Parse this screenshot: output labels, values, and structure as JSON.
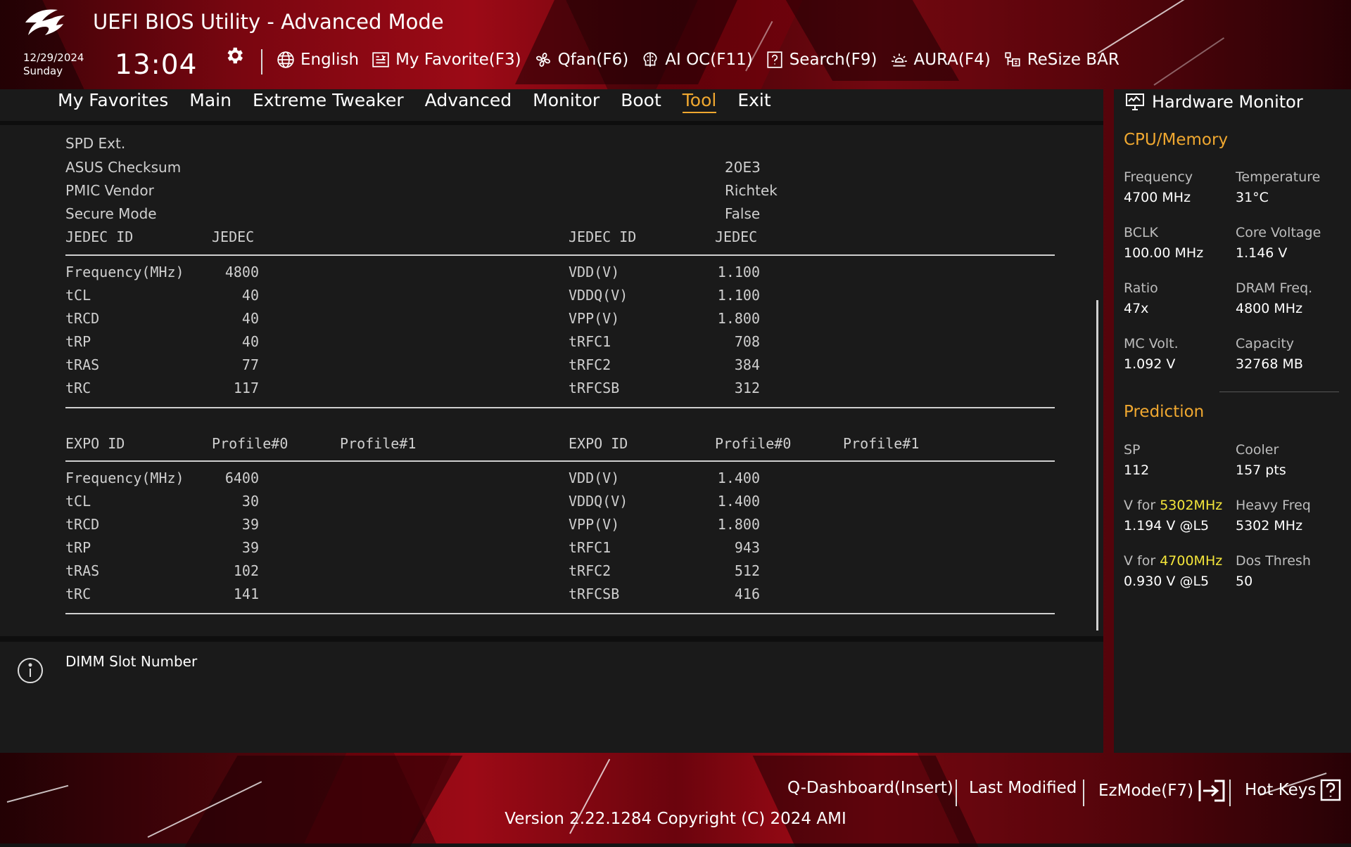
{
  "header": {
    "title": "UEFI BIOS Utility - Advanced Mode",
    "date": "12/29/2024",
    "day": "Sunday",
    "time": "13:04",
    "toolbar": [
      {
        "label": "English",
        "icon": "globe-icon"
      },
      {
        "label": "My Favorite(F3)",
        "icon": "favorite-list-icon"
      },
      {
        "label": "Qfan(F6)",
        "icon": "fan-icon"
      },
      {
        "label": "AI OC(F11)",
        "icon": "ai-chip-icon"
      },
      {
        "label": "Search(F9)",
        "icon": "search-question-icon"
      },
      {
        "label": "AURA(F4)",
        "icon": "aura-light-icon"
      },
      {
        "label": "ReSize BAR",
        "icon": "resize-bar-icon"
      }
    ]
  },
  "menu": {
    "tabs": [
      "My Favorites",
      "Main",
      "Extreme Tweaker",
      "Advanced",
      "Monitor",
      "Boot",
      "Tool",
      "Exit"
    ],
    "active": "Tool"
  },
  "spd": {
    "section": "SPD Ext.",
    "info": [
      {
        "label": "ASUS Checksum",
        "value": "20E3"
      },
      {
        "label": "PMIC Vendor",
        "value": "Richtek"
      },
      {
        "label": "Secure Mode",
        "value": "False"
      }
    ],
    "jedec": {
      "left_header": [
        "JEDEC ID",
        "JEDEC"
      ],
      "right_header": [
        "JEDEC ID",
        "JEDEC"
      ],
      "left_rows": [
        [
          "Frequency(MHz)",
          "4800"
        ],
        [
          "tCL",
          "40"
        ],
        [
          "tRCD",
          "40"
        ],
        [
          "tRP",
          "40"
        ],
        [
          "tRAS",
          "77"
        ],
        [
          "tRC",
          "117"
        ]
      ],
      "right_rows": [
        [
          "VDD(V)",
          "1.100"
        ],
        [
          "VDDQ(V)",
          "1.100"
        ],
        [
          "VPP(V)",
          "1.800"
        ],
        [
          "tRFC1",
          "708"
        ],
        [
          "tRFC2",
          "384"
        ],
        [
          "tRFCSB",
          "312"
        ]
      ]
    },
    "expo": {
      "left_header": [
        "EXPO ID",
        "Profile#0",
        "Profile#1"
      ],
      "right_header": [
        "EXPO ID",
        "Profile#0",
        "Profile#1"
      ],
      "left_rows": [
        [
          "Frequency(MHz)",
          "6400"
        ],
        [
          "tCL",
          "30"
        ],
        [
          "tRCD",
          "39"
        ],
        [
          "tRP",
          "39"
        ],
        [
          "tRAS",
          "102"
        ],
        [
          "tRC",
          "141"
        ]
      ],
      "right_rows": [
        [
          "VDD(V)",
          "1.400"
        ],
        [
          "VDDQ(V)",
          "1.400"
        ],
        [
          "VPP(V)",
          "1.800"
        ],
        [
          "tRFC1",
          "943"
        ],
        [
          "tRFC2",
          "512"
        ],
        [
          "tRFCSB",
          "416"
        ]
      ]
    }
  },
  "help": {
    "text": "DIMM Slot Number"
  },
  "hw": {
    "title": "Hardware Monitor",
    "cpu_section": "CPU/Memory",
    "cpu": [
      {
        "label": "Frequency",
        "value": "4700 MHz"
      },
      {
        "label": "Temperature",
        "value": "31°C"
      },
      {
        "label": "BCLK",
        "value": "100.00 MHz"
      },
      {
        "label": "Core Voltage",
        "value": "1.146 V"
      },
      {
        "label": "Ratio",
        "value": "47x"
      },
      {
        "label": "DRAM Freq.",
        "value": "4800 MHz"
      },
      {
        "label": "MC Volt.",
        "value": "1.092 V"
      },
      {
        "label": "Capacity",
        "value": "32768 MB"
      }
    ],
    "pred_section": "Prediction",
    "pred": {
      "sp_label": "SP",
      "sp_value": "112",
      "cooler_label": "Cooler",
      "cooler_value": "157 pts",
      "v1_prefix": "V for ",
      "v1_freq": "5302MHz",
      "v1_value": "1.194 V @L5",
      "heavy_label": "Heavy Freq",
      "heavy_value": "5302 MHz",
      "v2_prefix": "V for ",
      "v2_freq": "4700MHz",
      "v2_value": "0.930 V @L5",
      "dos_label": "Dos Thresh",
      "dos_value": "50"
    }
  },
  "footer": {
    "qdash": "Q-Dashboard(Insert)",
    "last_modified": "Last Modified",
    "ezmode": "EzMode(F7)",
    "hotkeys": "Hot Keys",
    "version": "Version 2.22.1284 Copyright (C) 2024 AMI"
  },
  "colors": {
    "accent": "#f0a830",
    "highlight": "#f5e63a",
    "brand_red": "#9c0a16"
  }
}
